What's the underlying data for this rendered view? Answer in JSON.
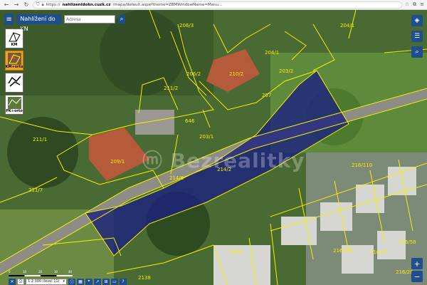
{
  "browser": {
    "url_prefix": "https://",
    "url_domain": "nahlizenidokn.cuzk.cz",
    "url_rest": "/mapa/default.aspx?theme=ZBMWindowName=Menu..."
  },
  "app": {
    "title": "Nahlížení do KN",
    "address_placeholder": "Adresa"
  },
  "layers": [
    {
      "label": "KM",
      "active": false
    },
    {
      "label": "KM+orto",
      "active": true
    },
    {
      "label": "",
      "active": false
    },
    {
      "label": "PK+orto",
      "active": false
    }
  ],
  "parcels": {
    "p1": "206/3",
    "p2": "204/1",
    "p3": "206/2",
    "p4": "211/2",
    "p5": "210/2",
    "p6": "204/1",
    "p7": "646",
    "p8": "211/1",
    "p9": "207",
    "p10": "203/1",
    "p11": "203/2",
    "p12": "209/1",
    "p13": "214/2",
    "p14": "214/6",
    "p15": "216/110",
    "p16": "216/116",
    "p17": "216/1",
    "p18": "216/47",
    "p19": "216/58",
    "p20": "2138",
    "p21": "216/28",
    "p22": "211/7"
  },
  "watermark": "ⓜ Bezrealitky",
  "bottom": {
    "scale_select": "1:2 000 (level 11)",
    "scale_ticks": [
      "0",
      "10",
      "20",
      "30",
      "40"
    ]
  },
  "colors": {
    "parcel_line": "#f3ef00",
    "selected_fill": "#1a1f80",
    "app_blue": "#1f4e8c"
  }
}
